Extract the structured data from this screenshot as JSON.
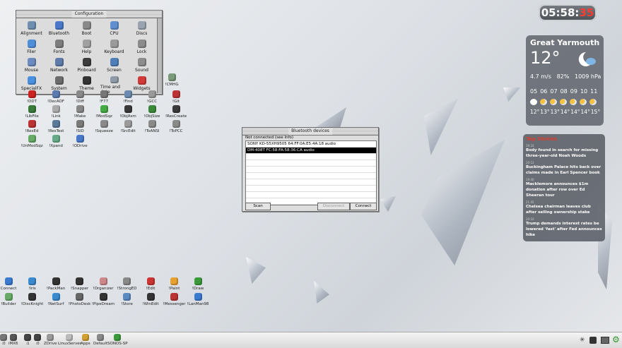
{
  "config": {
    "title": "Configuration",
    "items": [
      {
        "label": "Alignment",
        "color": "#6f8fb0"
      },
      {
        "label": "Bluetooth",
        "color": "#4a78c8"
      },
      {
        "label": "Boot",
        "color": "#8a8a8a"
      },
      {
        "label": "CPU",
        "color": "#5f8fd0"
      },
      {
        "label": "Discs",
        "color": "#9aa4b0"
      },
      {
        "label": "Filer",
        "color": "#4f8fd8"
      },
      {
        "label": "Fonts",
        "color": "#7d7d7d"
      },
      {
        "label": "Help",
        "color": "#a0a0a0"
      },
      {
        "label": "Keyboard",
        "color": "#9a9a9a"
      },
      {
        "label": "Lock",
        "color": "#8c8c8c"
      },
      {
        "label": "Mouse",
        "color": "#6a8ac0"
      },
      {
        "label": "Network",
        "color": "#5d7aa8"
      },
      {
        "label": "Pinboard",
        "color": "#3d3d3d"
      },
      {
        "label": "Screen",
        "color": "#4f7fb8"
      },
      {
        "label": "Sound",
        "color": "#8d8d8d"
      },
      {
        "label": "SpecialFX",
        "color": "#4a90e0"
      },
      {
        "label": "System",
        "color": "#6b6b6b"
      },
      {
        "label": "Theme",
        "color": "#333"
      },
      {
        "label": "Time and date",
        "color": "#8e9aa6"
      },
      {
        "label": "Widgets",
        "color": "#d23a3a"
      }
    ]
  },
  "desk_top": [
    {
      "label": "!CMHG",
      "color": "#7a9a7a"
    },
    {
      "label": "!DDT",
      "color": "#c22"
    },
    {
      "label": "!DecAOF",
      "color": "#5a7ab0"
    },
    {
      "label": "!Diff",
      "color": "#888"
    },
    {
      "label": "!F77",
      "color": "#777"
    },
    {
      "label": "!Find",
      "color": "#6a8ab0"
    },
    {
      "label": "!GCC",
      "color": "#999"
    },
    {
      "label": "!Git",
      "color": "#b33"
    },
    {
      "label": "!LibFile",
      "color": "#3a7a3a"
    },
    {
      "label": "!Link",
      "color": "#aaa"
    },
    {
      "label": "!Make",
      "color": "#888"
    },
    {
      "label": "!ModSqz",
      "color": "#4a4"
    },
    {
      "label": "!ObjAsm",
      "color": "#3a3a3a"
    },
    {
      "label": "!ObjSize",
      "color": "#3a8a3a"
    },
    {
      "label": "!ResCreate",
      "color": "#3a3a3a"
    },
    {
      "label": "!ResEd",
      "color": "#b33"
    },
    {
      "label": "!ResTest",
      "color": "#5a7a9a"
    },
    {
      "label": "!SID",
      "color": "#7a7a7a"
    },
    {
      "label": "!Squeeze",
      "color": "#8a8a8a"
    },
    {
      "label": "!SrcEdit",
      "color": "#999"
    },
    {
      "label": "!ToANSI",
      "color": "#8a8a8a"
    },
    {
      "label": "!ToPCC",
      "color": "#8a8a8a"
    },
    {
      "label": "!UnModSqz",
      "color": "#6a6"
    },
    {
      "label": "!Xpand",
      "color": "#6a8"
    },
    {
      "label": "!ODrive",
      "color": "#4a78c8"
    }
  ],
  "desk_bottom": [
    {
      "label": "Connect",
      "color": "#3a7ad0"
    },
    {
      "label": "!Iris",
      "color": "#3a8ad0"
    },
    {
      "label": "!PackMan",
      "color": "#333"
    },
    {
      "label": "!Snapper",
      "color": "#333"
    },
    {
      "label": "!Organizer",
      "color": "#c88"
    },
    {
      "label": "!StrongED",
      "color": "#888"
    },
    {
      "label": "!Edit",
      "color": "#c33"
    },
    {
      "label": "!Paint",
      "color": "#e8a030"
    },
    {
      "label": "!Draw",
      "color": "#3a9a3a"
    },
    {
      "label": "!Builder",
      "color": "#6a6"
    },
    {
      "label": "!DiscKnight",
      "color": "#333"
    },
    {
      "label": "!NetSurf",
      "color": "#3a8ad0"
    },
    {
      "label": "!PhotoDesk",
      "color": "#666"
    },
    {
      "label": "!PipeDream",
      "color": "#333"
    },
    {
      "label": "!Store",
      "color": "#5a8ac0"
    },
    {
      "label": "!WinEdit",
      "color": "#333"
    },
    {
      "label": "!Messenger",
      "color": "#b33"
    },
    {
      "label": "!LanMan98",
      "color": "#3a7ad0"
    }
  ],
  "bluetooth": {
    "title": "Bluetooth devices",
    "status": "Not connected (see Info)",
    "devices": [
      "SONY KD-55XH9505   64:FF:0A:E5:4A:18   audio",
      "DM-408T   FC:58:FA:58:36:CA   audio"
    ],
    "selected_index": 1,
    "empty_rows": 8,
    "scan": "Scan",
    "disconnect": "Disconnect",
    "connect": "Connect"
  },
  "clock": {
    "hm": "05:58:",
    "sec": "35",
    "sec_color": "#ff3b30"
  },
  "weather": {
    "city": "Great Yarmouth",
    "temp": "12°",
    "wind": "4.7 m/s",
    "humidity": "82%",
    "pressure": "1009 hPa",
    "hours": [
      "05",
      "06",
      "07",
      "08",
      "09",
      "10",
      "11"
    ],
    "temps": [
      "12°",
      "13°",
      "13°",
      "14°",
      "14°",
      "14°",
      "15°"
    ]
  },
  "news": {
    "title": "Top Stories",
    "title_color": "#e03c2c",
    "items": [
      {
        "time": "19:32",
        "text": "Body found in search for missing three-year-old Noah Woods"
      },
      {
        "time": "20:12",
        "text": "Buckingham Palace hits back over claims made in Earl Spencer book"
      },
      {
        "time": "19:40",
        "text": "Macklemore announces $1m donation after row over Ed Sheeran tour"
      },
      {
        "time": "21:45",
        "text": "Chelsea chairman leaves club after selling ownership stake"
      },
      {
        "time": "20:10",
        "text": "Trump demands interest rates be lowered 'fast' after Fed announces hike"
      }
    ]
  },
  "taskbar": [
    {
      "label": ":0",
      "color": "#777"
    },
    {
      "label": "iMX6",
      "color": "#555"
    },
    {
      "label": ":1",
      "color": "#444"
    },
    {
      "label": ":0",
      "color": "#444"
    },
    {
      "label": "ZDrive",
      "color": "#999"
    },
    {
      "label": "LinuxServer",
      "color": "#bbb"
    },
    {
      "label": "Apps",
      "color": "#d2a030"
    },
    {
      "label": "Default",
      "color": "#888"
    },
    {
      "label": "SONOS-SP",
      "color": "#3a9a3a"
    }
  ]
}
